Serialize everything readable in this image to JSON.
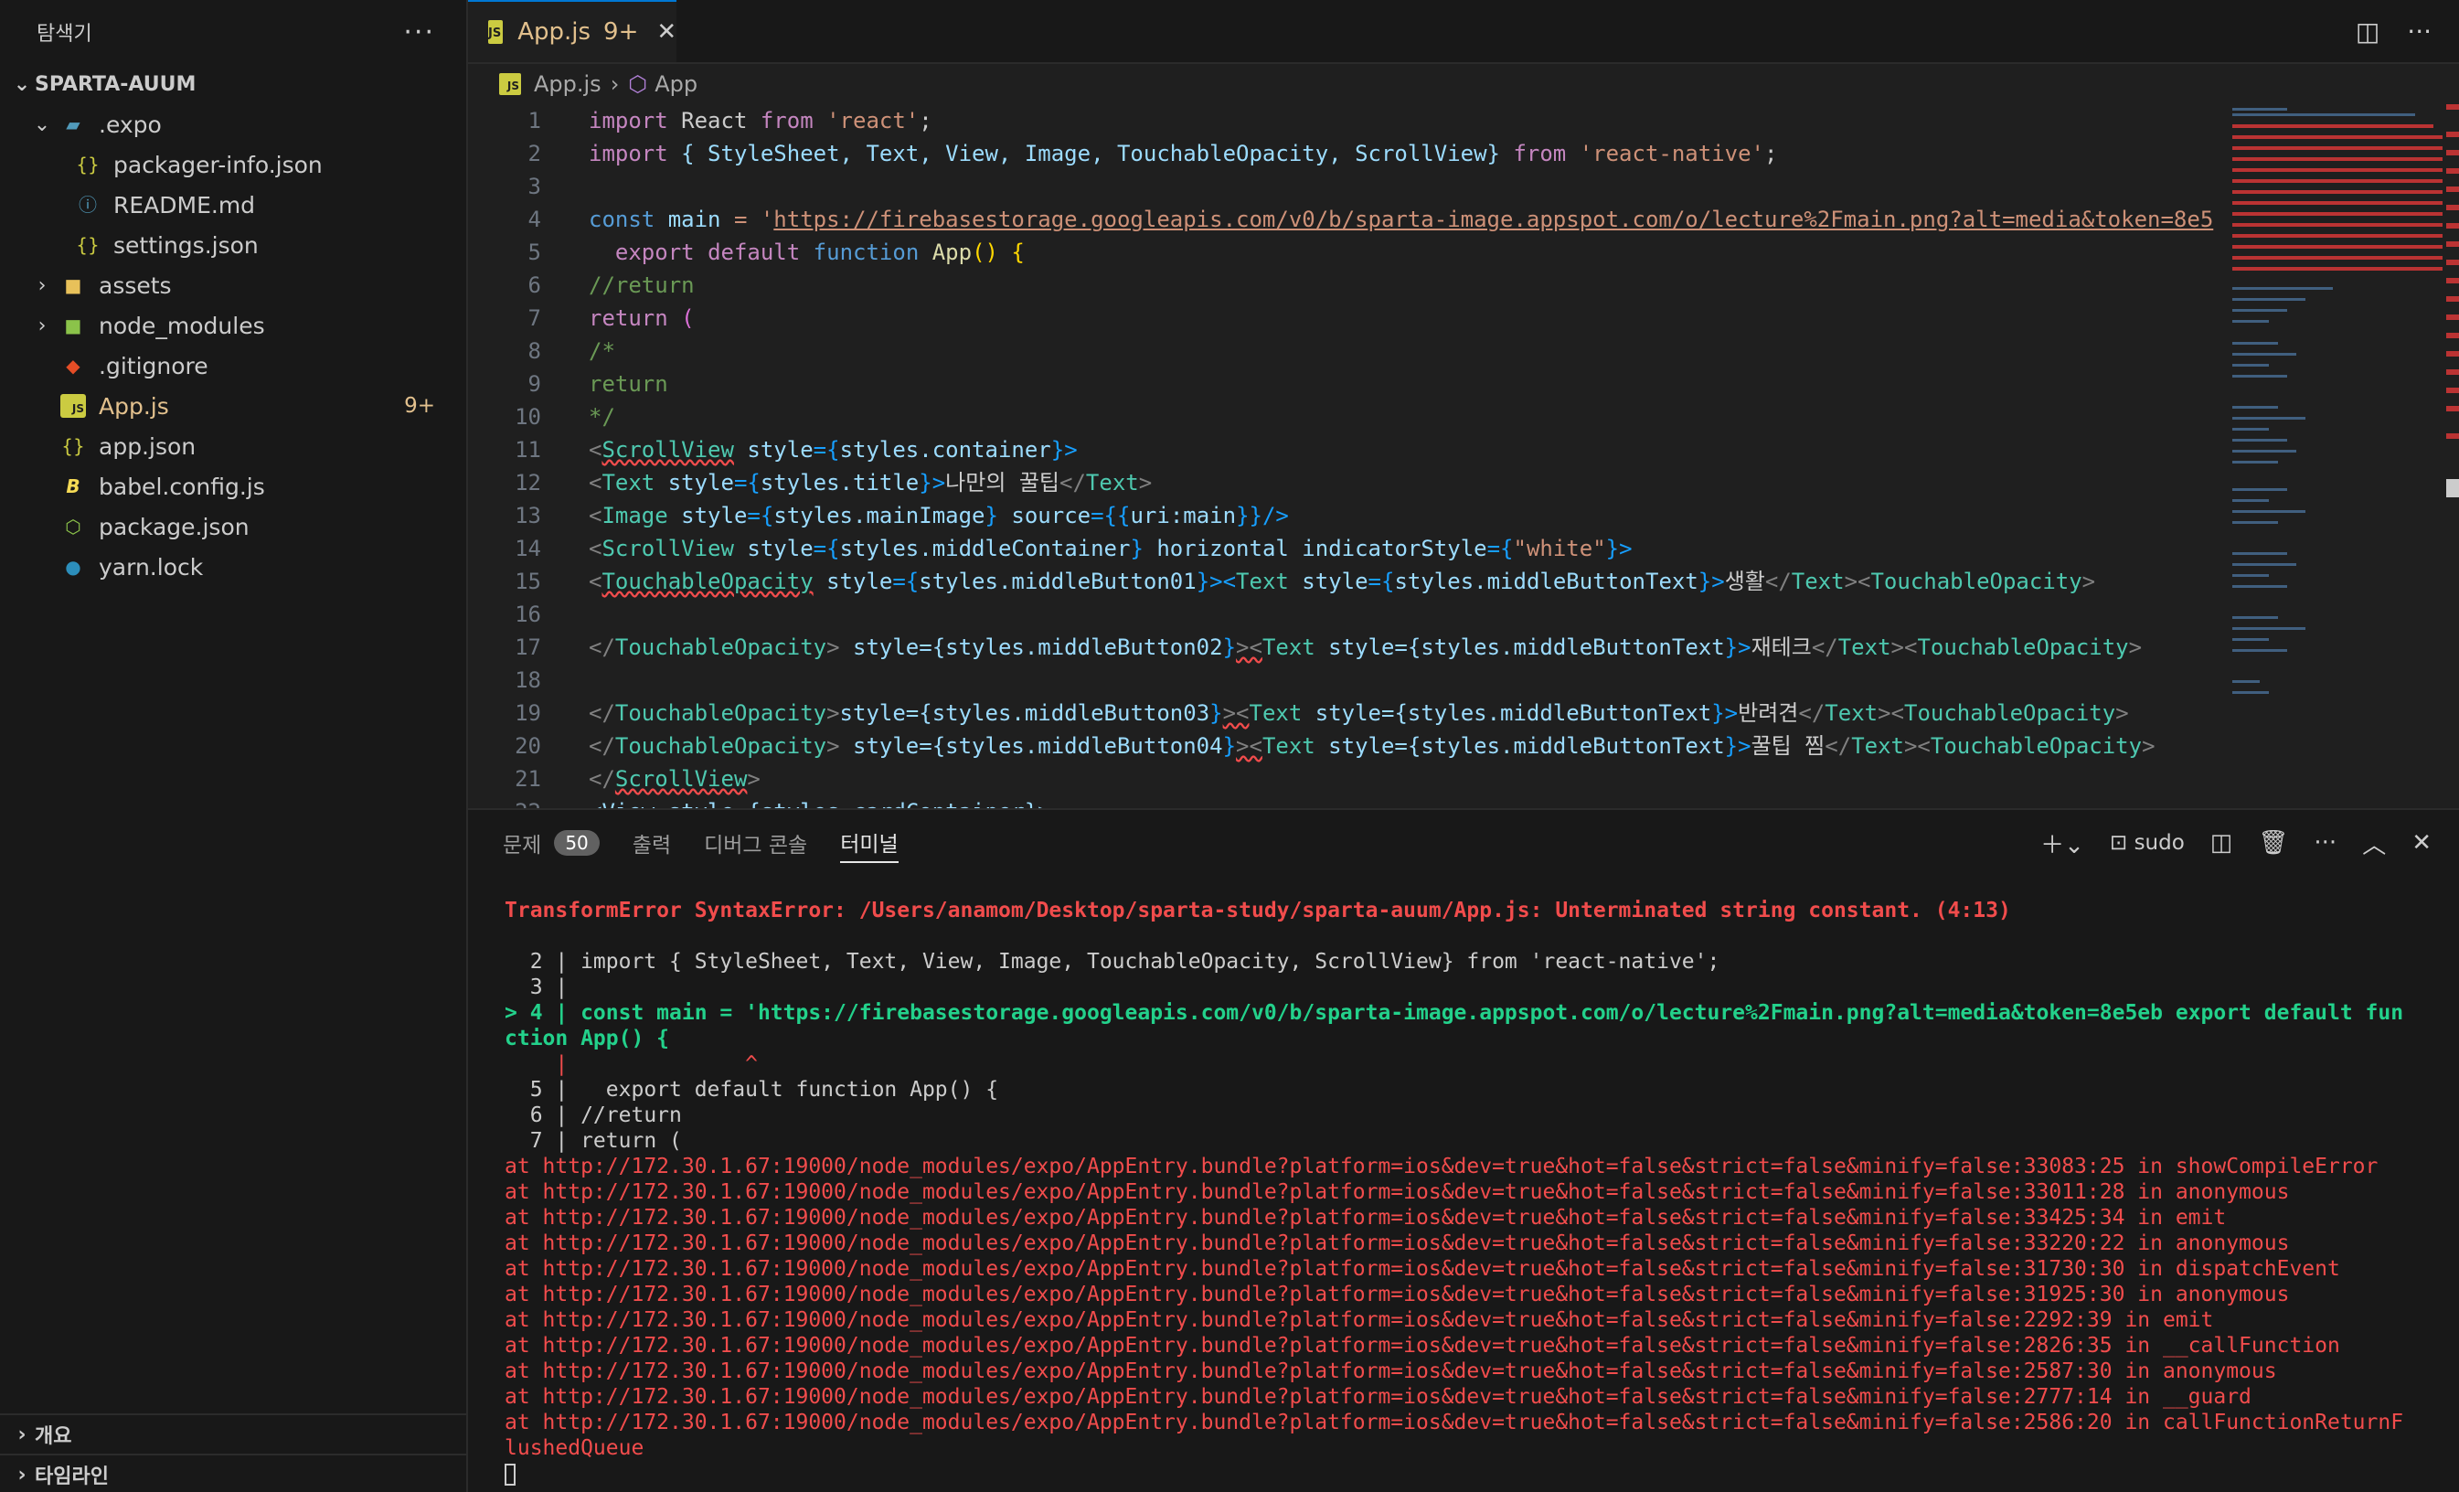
{
  "sidebar": {
    "title": "탐색기",
    "more": "···",
    "project": "SPARTA-AUUM",
    "items": [
      {
        "label": ".expo",
        "badge": ""
      },
      {
        "label": "packager-info.json",
        "badge": ""
      },
      {
        "label": "README.md",
        "badge": ""
      },
      {
        "label": "settings.json",
        "badge": ""
      },
      {
        "label": "assets",
        "badge": ""
      },
      {
        "label": "node_modules",
        "badge": ""
      },
      {
        "label": ".gitignore",
        "badge": ""
      },
      {
        "label": "App.js",
        "badge": "9+"
      },
      {
        "label": "app.json",
        "badge": ""
      },
      {
        "label": "babel.config.js",
        "badge": ""
      },
      {
        "label": "package.json",
        "badge": ""
      },
      {
        "label": "yarn.lock",
        "badge": ""
      }
    ],
    "outline": "개요",
    "timeline": "타임라인"
  },
  "editor": {
    "tab": {
      "label": "App.js",
      "count": "9+"
    },
    "breadcrumb": {
      "file": "App.js",
      "symbol": "App"
    }
  },
  "code": {
    "l1a": "import",
    "l1b": " React ",
    "l1c": "from",
    "l1d": "'react'",
    "l1e": ";",
    "l2a": "import",
    "l2b": " { StyleSheet, Text, View, Image, TouchableOpacity, ScrollView} ",
    "l2c": "from",
    "l2d": "'react-native'",
    "l2e": ";",
    "l4a": "const",
    "l4b": "main",
    "l4c": " = '",
    "l4d": "https://firebasestorage.googleapis.com/v0/b/sparta-image.appspot.com/o/lecture%2Fmain.png?alt=media&token=8e5",
    "l5a": "export",
    "l5b": "default",
    "l5c": "function",
    "l5d": "App",
    "l5e": "() {",
    "l6": "//return",
    "l7a": "return",
    "l7b": " (",
    "l8": "/*",
    "l9": "return",
    "l10": "*/",
    "l11a": "<",
    "l11b": "ScrollView",
    "l11c": " style",
    "l11d": "={",
    "l11e": "styles.container",
    "l11f": "}>",
    "l12a": "<",
    "l12b": "Text",
    "l12c": " style",
    "l12d": "={",
    "l12e": "styles.title",
    "l12f": "}>",
    "l12g": "나만의 꿀팁",
    "l12h": "</",
    "l12i": "Text",
    "l12j": ">",
    "l13a": "<",
    "l13b": "Image",
    "l13c": " style",
    "l13d": "={",
    "l13e": "styles.mainImage",
    "l13f": "}",
    "l13g": " source",
    "l13h": "={{",
    "l13i": "uri:main",
    "l13j": "}}/>",
    "l14a": "<",
    "l14b": "ScrollView",
    "l14c": " style",
    "l14d": "={",
    "l14e": "styles.middleContainer",
    "l14f": "}",
    "l14g": " horizontal indicatorStyle",
    "l14h": "={",
    "l14i": "\"white\"",
    "l14j": "}>",
    "l15a": "<",
    "l15b": "TouchableOpacity",
    "l15c": " style",
    "l15d": "={",
    "l15e": "styles.middleButton01",
    "l15f": "}><",
    "l15g": "Text",
    "l15h": " style",
    "l15i": "={",
    "l15j": "styles.middleButtonText",
    "l15k": "}>",
    "l15l": "생활",
    "l15m": "</",
    "l15n": "Text",
    "l15o": "><",
    "l15p": "TouchableOpacity",
    "l15q": ">",
    "l17a": "</",
    "l17b": "TouchableOpacity",
    "l17c": ">",
    "l17d": " style={",
    "l17e": "styles.middleButton02",
    "l17f": "}",
    "l17g": "><",
    "l17h": "Text",
    "l17i": " style={",
    "l17j": "styles.middleButtonText",
    "l17k": "}>",
    "l17l": "재테크",
    "l17m": "</",
    "l17n": "Text",
    "l17o": "><",
    "l17p": "TouchableOpacity",
    "l17q": ">",
    "l19a": "</",
    "l19b": "TouchableOpacity",
    "l19c": ">",
    "l19d": "style={",
    "l19e": "styles.middleButton03",
    "l19f": "}",
    "l19g": "><",
    "l19h": "Text",
    "l19i": " style={",
    "l19j": "styles.middleButtonText",
    "l19k": "}>",
    "l19l": "반려견",
    "l19m": "</",
    "l19n": "Text",
    "l19o": "><",
    "l19p": "TouchableOpacity",
    "l19q": ">",
    "l20a": "</",
    "l20b": "TouchableOpacity",
    "l20c": ">",
    "l20d": " style={",
    "l20e": "styles.middleButton04",
    "l20f": "}",
    "l20g": "><",
    "l20h": "Text",
    "l20i": " style={",
    "l20j": "styles.middleButtonText",
    "l20k": "}>",
    "l20l": "꿀팁 찜",
    "l20m": "</",
    "l20n": "Text",
    "l20o": "><",
    "l20p": "TouchableOpacity",
    "l20q": ">",
    "l21a": "</",
    "l21b": "ScrollView",
    "l21c": ">",
    "l22": "<View style={styles.cardContainer}>"
  },
  "panel": {
    "tabs": [
      "문제",
      "출력",
      "디버그 콘솔",
      "터미널"
    ],
    "problems_count": "50",
    "shell": "sudo"
  },
  "terminal": {
    "error": "TransformError SyntaxError: /Users/anamom/Desktop/sparta-study/sparta-auum/App.js: Unterminated string constant. (4:13)",
    "c2": "  2 | import { StyleSheet, Text, View, Image, TouchableOpacity, ScrollView} from 'react-native';",
    "c3": "  3 |",
    "c4": "> 4 | const main = 'https://firebasestorage.googleapis.com/v0/b/sparta-image.appspot.com/o/lecture%2Fmain.png?alt=media&token=8e5eb export default fun",
    "c4b": "ction App() {",
    "caret": "    |              ^",
    "c5": "  5 |   export default function App() {",
    "c6": "  6 | //return",
    "c7": "  7 | return (",
    "stack": [
      "at http://172.30.1.67:19000/node_modules/expo/AppEntry.bundle?platform=ios&dev=true&hot=false&strict=false&minify=false:33083:25 in showCompileError",
      "at http://172.30.1.67:19000/node_modules/expo/AppEntry.bundle?platform=ios&dev=true&hot=false&strict=false&minify=false:33011:28 in anonymous",
      "at http://172.30.1.67:19000/node_modules/expo/AppEntry.bundle?platform=ios&dev=true&hot=false&strict=false&minify=false:33425:34 in emit",
      "at http://172.30.1.67:19000/node_modules/expo/AppEntry.bundle?platform=ios&dev=true&hot=false&strict=false&minify=false:33220:22 in anonymous",
      "at http://172.30.1.67:19000/node_modules/expo/AppEntry.bundle?platform=ios&dev=true&hot=false&strict=false&minify=false:31730:30 in dispatchEvent",
      "at http://172.30.1.67:19000/node_modules/expo/AppEntry.bundle?platform=ios&dev=true&hot=false&strict=false&minify=false:31925:30 in anonymous",
      "at http://172.30.1.67:19000/node_modules/expo/AppEntry.bundle?platform=ios&dev=true&hot=false&strict=false&minify=false:2292:39 in emit",
      "at http://172.30.1.67:19000/node_modules/expo/AppEntry.bundle?platform=ios&dev=true&hot=false&strict=false&minify=false:2826:35 in __callFunction",
      "at http://172.30.1.67:19000/node_modules/expo/AppEntry.bundle?platform=ios&dev=true&hot=false&strict=false&minify=false:2587:30 in anonymous",
      "at http://172.30.1.67:19000/node_modules/expo/AppEntry.bundle?platform=ios&dev=true&hot=false&strict=false&minify=false:2777:14 in __guard",
      "at http://172.30.1.67:19000/node_modules/expo/AppEntry.bundle?platform=ios&dev=true&hot=false&strict=false&minify=false:2586:20 in callFunctionReturnF",
      "lushedQueue"
    ]
  }
}
